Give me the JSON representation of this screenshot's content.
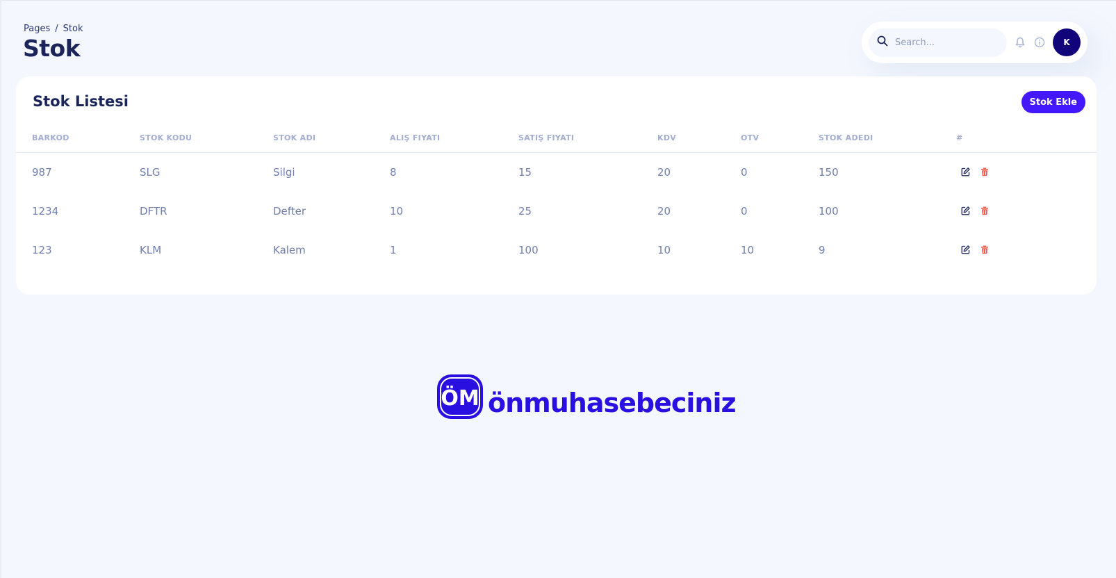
{
  "breadcrumb": {
    "root": "Pages",
    "separator": "/",
    "current": "Stok"
  },
  "page_title": "Stok",
  "search": {
    "placeholder": "Search..."
  },
  "header_icons": [
    "search-icon",
    "bell-icon",
    "info-icon"
  ],
  "avatar": {
    "initial": "K",
    "color": "#11047a"
  },
  "card": {
    "title": "Stok Listesi",
    "add_button": "Stok Ekle",
    "columns": [
      "BARKOD",
      "STOK KODU",
      "STOK ADI",
      "ALIŞ FIYATI",
      "SATIŞ FIYATI",
      "KDV",
      "OTV",
      "STOK ADEDI",
      "#"
    ],
    "rows": [
      {
        "barkod": "987",
        "kod": "SLG",
        "ad": "Silgi",
        "alis": "8",
        "satis": "15",
        "kdv": "20",
        "otv": "0",
        "adet": "150"
      },
      {
        "barkod": "1234",
        "kod": "DFTR",
        "ad": "Defter",
        "alis": "10",
        "satis": "25",
        "kdv": "20",
        "otv": "0",
        "adet": "100"
      },
      {
        "barkod": "123",
        "kod": "KLM",
        "ad": "Kalem",
        "alis": "1",
        "satis": "100",
        "kdv": "10",
        "otv": "10",
        "adet": "9"
      }
    ],
    "row_actions": [
      "edit-icon",
      "delete-icon"
    ]
  },
  "logo": {
    "text": "önmuhasebeciniz",
    "mark_letters": "ÖM"
  },
  "colors": {
    "accent": "#4318ff",
    "brand": "#2a10e0",
    "danger": "#ee5d50",
    "text_primary": "#1b2559",
    "text_secondary": "#707eae"
  }
}
